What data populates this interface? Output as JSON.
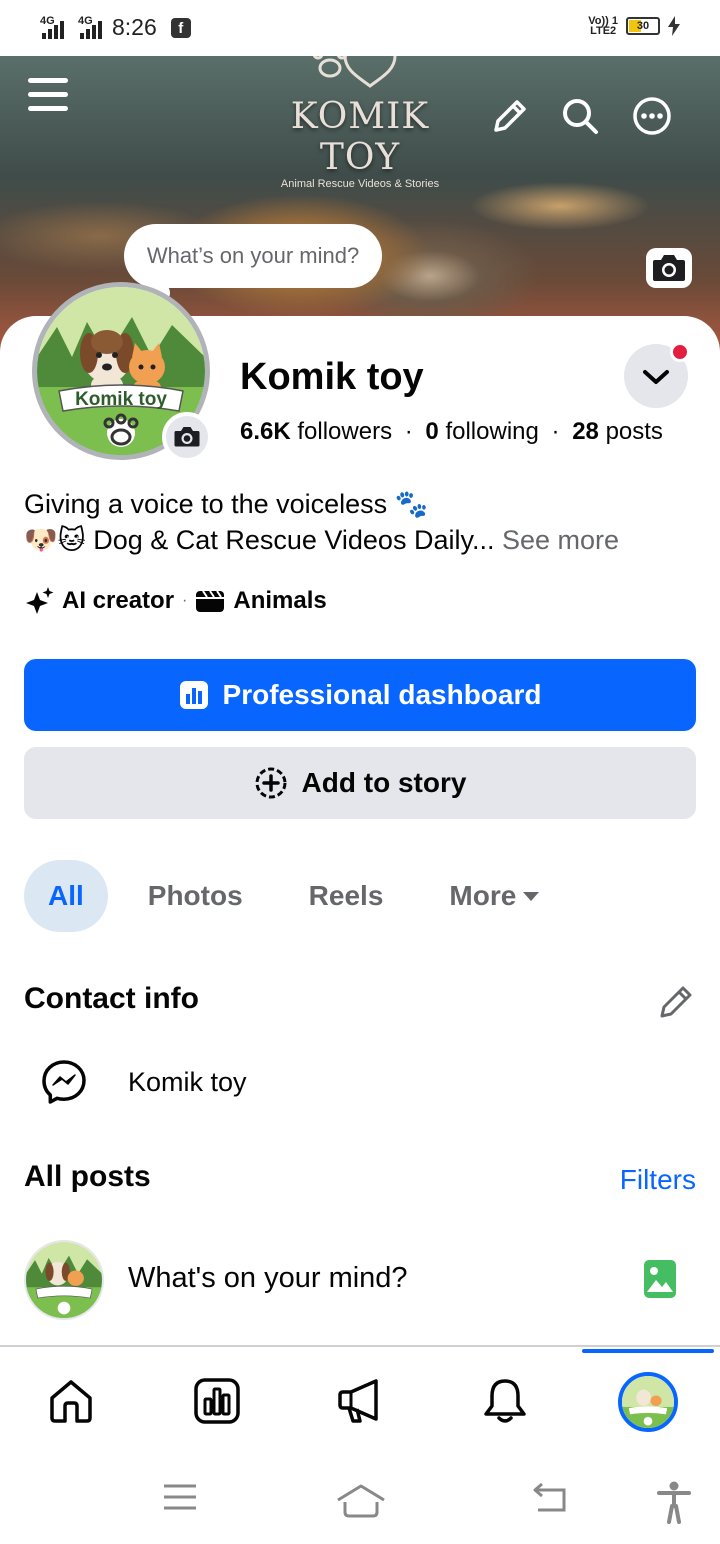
{
  "status_bar": {
    "network1": "4G",
    "network2": "4G",
    "time": "8:26",
    "volte": "Vo)) 1",
    "lte": "LTE2",
    "battery": "30"
  },
  "cover": {
    "brand_title": "KOMIK TOY",
    "brand_subtitle": "Animal Rescue Videos & Stories",
    "icons": [
      "menu-icon",
      "pencil-icon",
      "search-icon",
      "more-icon",
      "camera-icon"
    ]
  },
  "story_bubble": "What’s on your mind?",
  "profile": {
    "avatar_label": "Komik toy",
    "name": "Komik toy",
    "followers_count": "6.6K",
    "followers_label": "followers",
    "following_count": "0",
    "following_label": "following",
    "posts_count": "28",
    "posts_label": "posts",
    "bio_line1": "Giving a voice to the voiceless 🐾",
    "bio_line2": "🐶🐱 Dog & Cat Rescue Videos Daily...",
    "see_more": "See more",
    "category1": "AI creator",
    "category2": "Animals"
  },
  "buttons": {
    "dashboard": "Professional dashboard",
    "add_story": "Add to story"
  },
  "tabs": [
    {
      "label": "All",
      "active": true
    },
    {
      "label": "Photos",
      "active": false
    },
    {
      "label": "Reels",
      "active": false
    },
    {
      "label": "More",
      "active": false
    }
  ],
  "contact": {
    "title": "Contact info",
    "messenger_name": "Komik toy"
  },
  "posts": {
    "title": "All posts",
    "filters": "Filters",
    "composer_placeholder": "What's on your mind?"
  },
  "bottom_nav": [
    "home-icon",
    "dashboard-icon",
    "megaphone-icon",
    "bell-icon",
    "profile-avatar"
  ],
  "colors": {
    "accent": "#0866ff",
    "secondary_button": "#e4e6eb",
    "active_tab_bg": "#dbe7f2",
    "notification_dot": "#e41e3f",
    "photo_icon": "#45bd62"
  }
}
